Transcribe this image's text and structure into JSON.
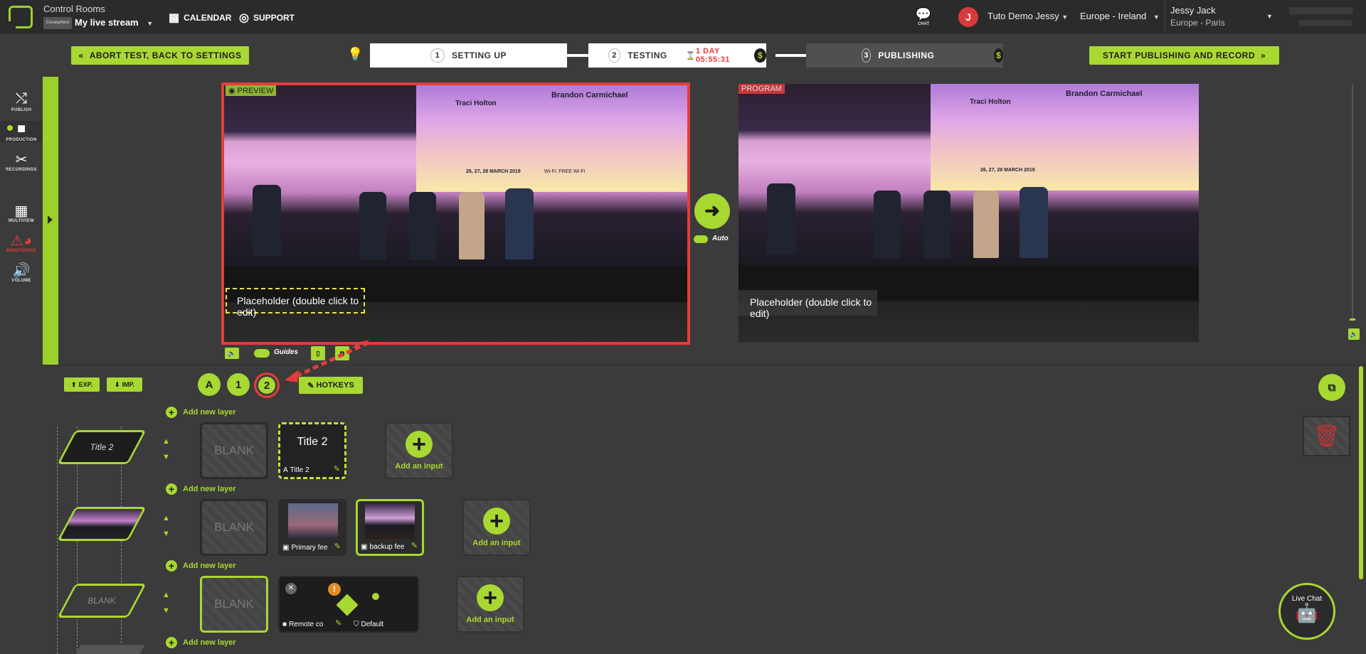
{
  "header": {
    "control_rooms": "Control Rooms",
    "badge": "Coraisphere",
    "stream_name": "My live stream",
    "calendar": "CALENDAR",
    "support": "SUPPORT",
    "chat": "CHAT",
    "avatar_initial": "J",
    "account": "Tuto Demo Jessy",
    "region": "Europe - Ireland",
    "user_name": "Jessy Jack",
    "user_tz": "Europe - Paris"
  },
  "actions": {
    "abort": "ABORT TEST, BACK TO SETTINGS",
    "start": "START PUBLISHING AND RECORD",
    "steps": [
      {
        "num": "1",
        "label": "SETTING UP"
      },
      {
        "num": "2",
        "label": "TESTING",
        "timer": "1 DAY 05:55:31"
      },
      {
        "num": "3",
        "label": "PUBLISHING"
      }
    ],
    "dollar": "$"
  },
  "sidebar": {
    "items": [
      {
        "label": "PUBLISH",
        "icon": "shuffle-icon"
      },
      {
        "label": "PRODUCTION",
        "icon": "camera-icon"
      },
      {
        "label": "RECORDINGS",
        "icon": "scissors-icon"
      },
      {
        "label": "MULTIVIEW",
        "icon": "grid-icon"
      },
      {
        "label": "MONITORING",
        "icon": "gauge-icon"
      },
      {
        "label": "VOLUME",
        "icon": "speaker-icon"
      }
    ]
  },
  "preview": {
    "tag": "PREVIEW",
    "placeholder": "Placeholder (double click to edit)",
    "guides": "Guides",
    "screen_line1": "Brandon Carmichael",
    "screen_line2": "Traci Holton",
    "screen_date": "26, 27, 28 MARCH 2019",
    "screen_wifi": "Wi-Fi: FREE Wi-Fi"
  },
  "program": {
    "tag": "PROGRAM",
    "placeholder": "Placeholder (double click to edit)"
  },
  "auto_label": "Auto",
  "panel": {
    "export": "EXP.",
    "import": "IMP.",
    "scenes": [
      "A",
      "1",
      "2"
    ],
    "hotkeys": "HOTKEYS",
    "add_layer": "Add new layer",
    "blank": "BLANK",
    "add_input": "Add an input",
    "layer1_thumb": "Title 2",
    "layer3_thumb": "BLANK",
    "title_tile_text": "Title 2",
    "title_tile_label": "Title 2",
    "primary_label": "Primary fee",
    "backup_label": "backup fee",
    "remote_label": "Remote co",
    "default_label": "Default"
  },
  "livechat": "Live Chat",
  "colors": {
    "accent": "#a8d832",
    "danger": "#e63b3b",
    "bg": "#3b3b3b",
    "topbar": "#2b2b2b"
  }
}
